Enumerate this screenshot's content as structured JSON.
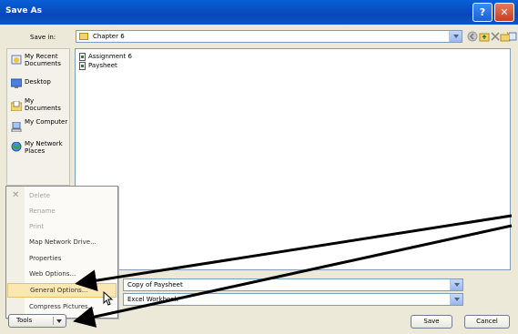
{
  "window": {
    "title": "Save As"
  },
  "save_in": {
    "label": "Save in:",
    "value": "Chapter 6"
  },
  "toolbar": {
    "icons": [
      "back-icon",
      "up-folder-icon",
      "search-web-icon",
      "delete-icon",
      "new-folder-icon",
      "views-icon"
    ]
  },
  "places": [
    {
      "label": "My Recent Documents",
      "icon": "recent-docs-icon"
    },
    {
      "label": "Desktop",
      "icon": "desktop-icon"
    },
    {
      "label": "My Documents",
      "icon": "my-documents-icon"
    },
    {
      "label": "My Computer",
      "icon": "my-computer-icon"
    },
    {
      "label": "My Network Places",
      "icon": "network-places-icon"
    }
  ],
  "files": [
    {
      "name": "Assignment 6"
    },
    {
      "name": "Paysheet"
    }
  ],
  "tools_menu": {
    "items": [
      {
        "label": "Delete",
        "disabled": true
      },
      {
        "label": "Rename",
        "disabled": true
      },
      {
        "label": "Print",
        "disabled": true
      },
      {
        "label": "Map Network Drive...",
        "disabled": false
      },
      {
        "label": "Properties",
        "disabled": false
      },
      {
        "label": "Web Options...",
        "disabled": false
      },
      {
        "label": "General Options...",
        "disabled": false,
        "highlighted": true
      },
      {
        "label": "Compress Pictures...",
        "disabled": false
      }
    ]
  },
  "file_name": {
    "value": "Copy of Paysheet"
  },
  "file_type": {
    "value": "Excel Workbook"
  },
  "buttons": {
    "tools": "Tools",
    "save": "Save",
    "cancel": "Cancel"
  },
  "colors": {
    "titlebar": "#0a5fd8",
    "dialog_bg": "#ece9d8",
    "highlight": "#fbe7b3",
    "arrow": "#000000"
  }
}
